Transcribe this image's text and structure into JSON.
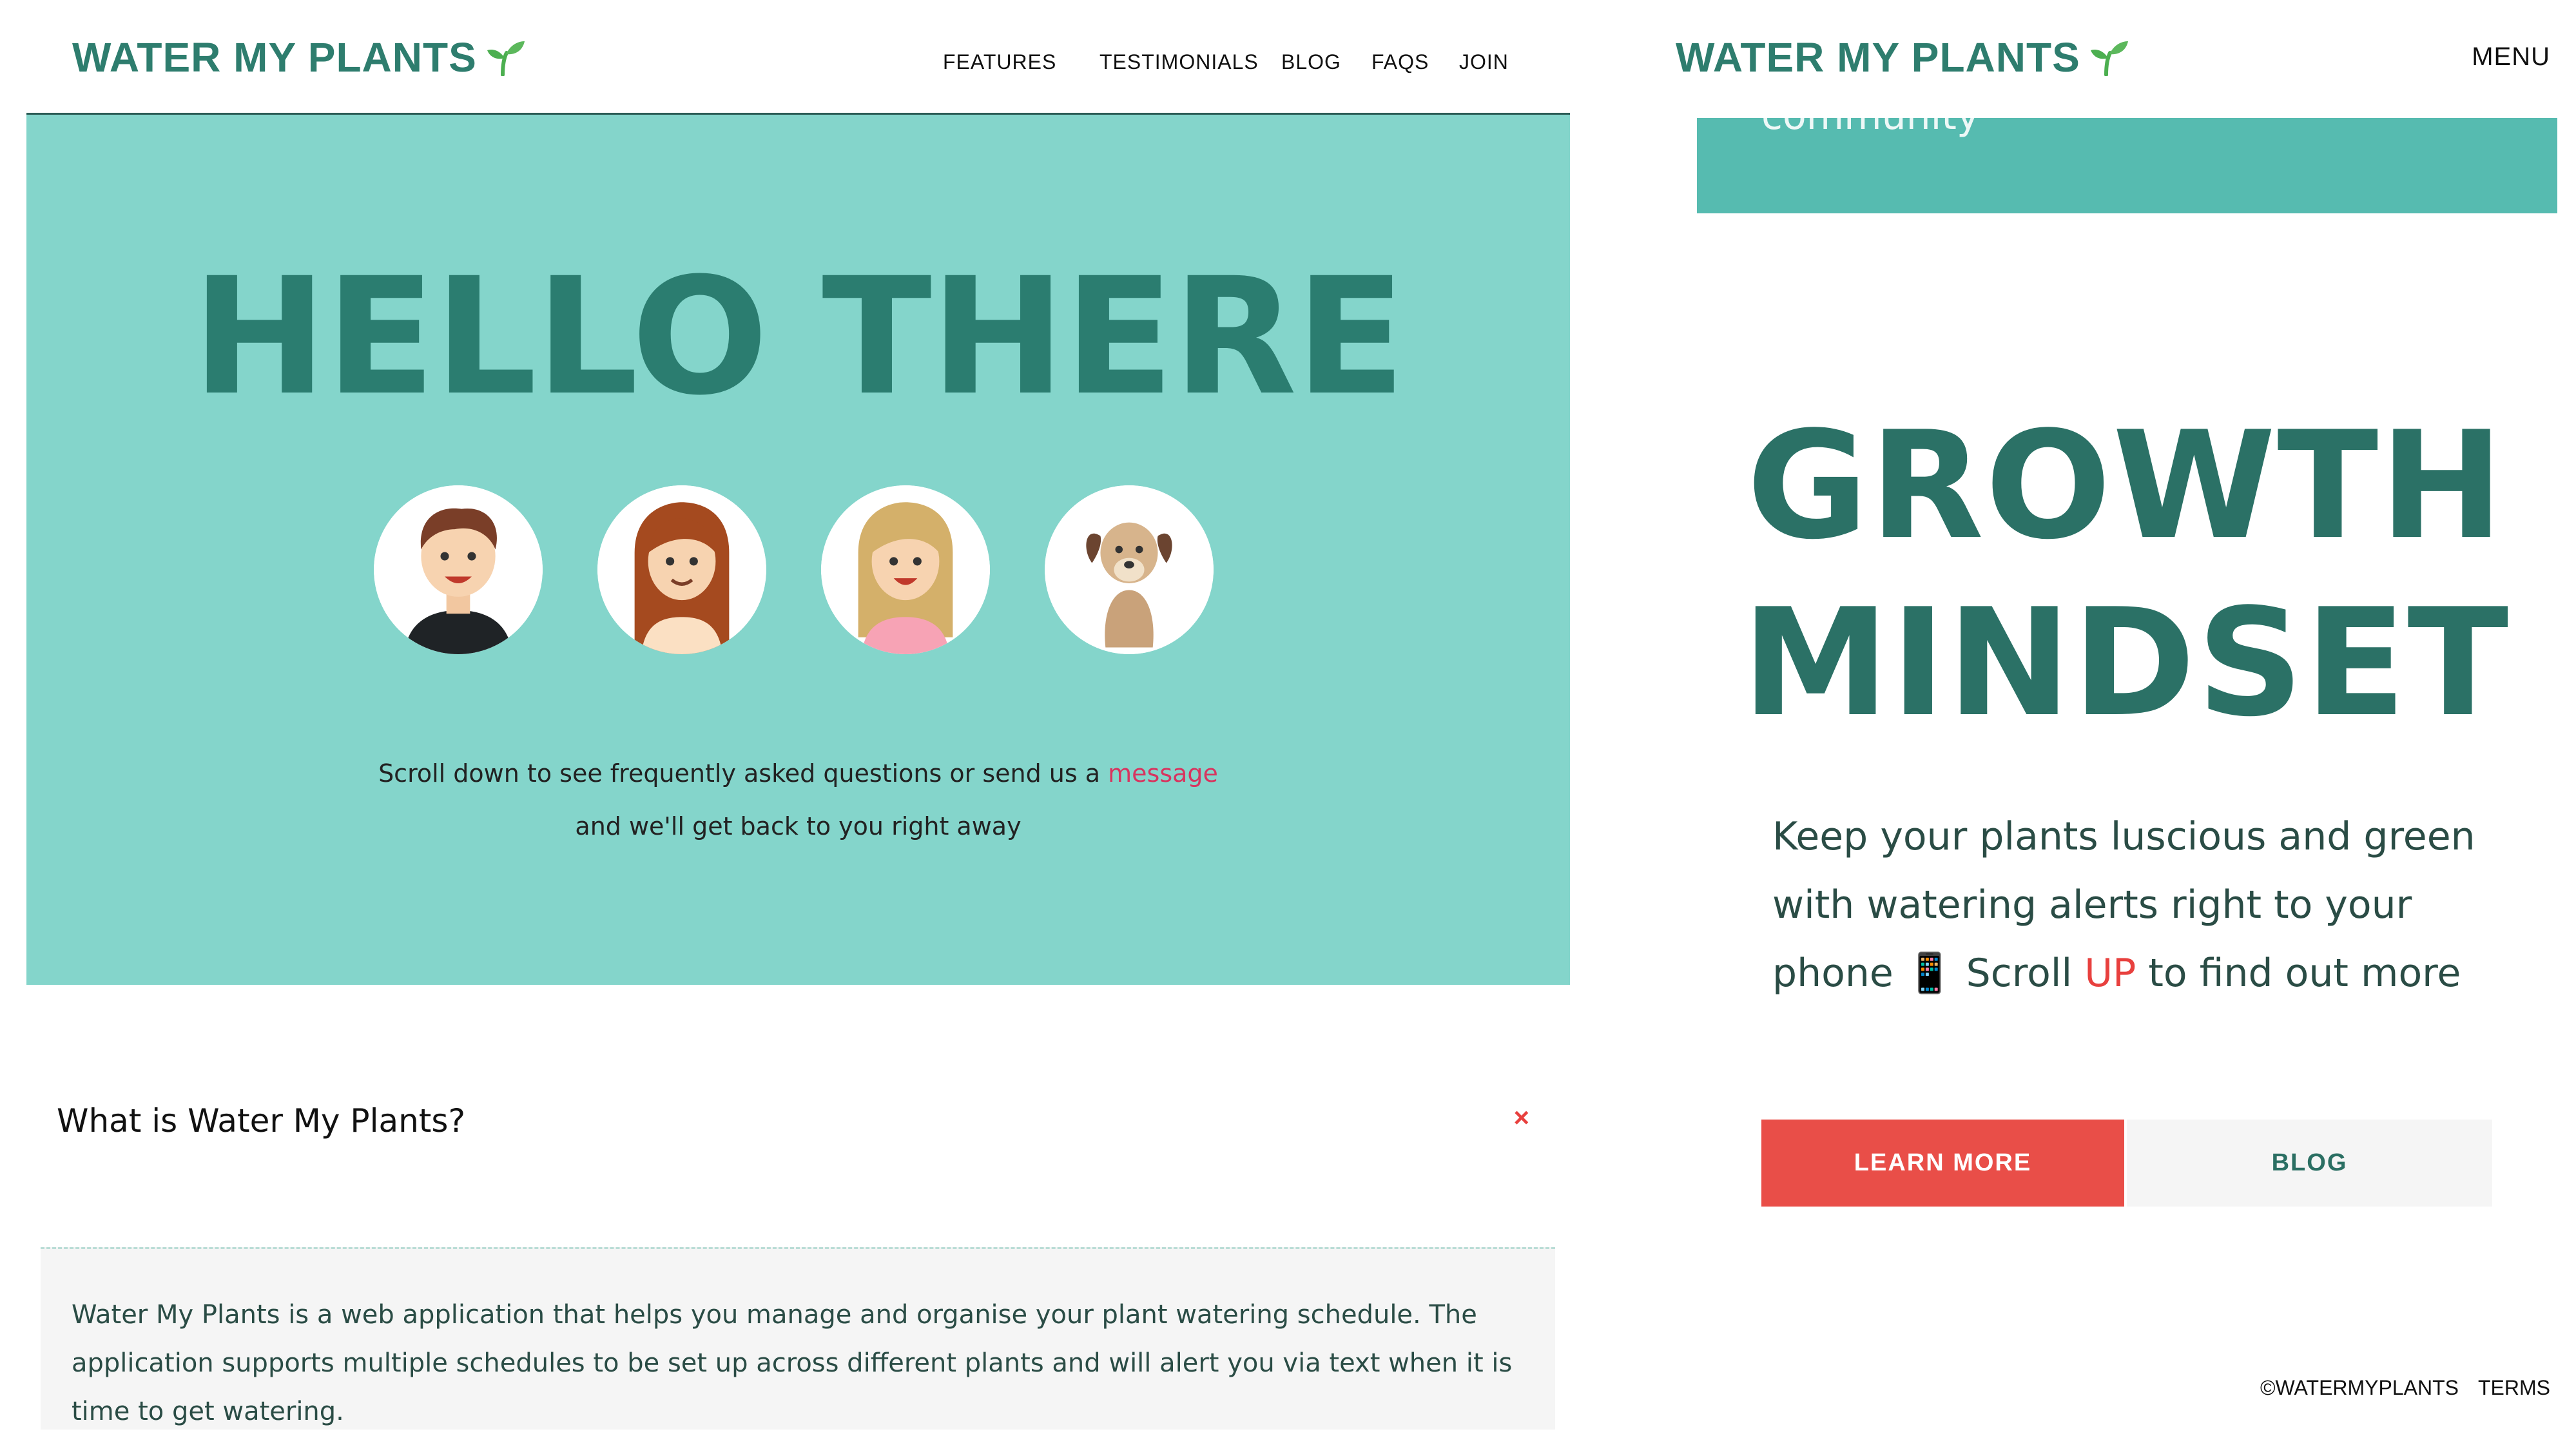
{
  "left_page": {
    "logo_text": "WATER MY PLANTS",
    "nav": [
      "FEATURES",
      "TESTIMONIALS",
      "BLOG",
      "FAQS",
      "JOIN"
    ],
    "hero": {
      "title": "HELLO THERE",
      "line1_prefix": "Scroll down to see frequently asked questions or send us a",
      "line1_link": "message",
      "line2": "and we'll get back to you right away"
    },
    "avatars": [
      "man-avatar",
      "woman-redhead-avatar",
      "woman-blonde-avatar",
      "dog-avatar"
    ],
    "faq": {
      "question": "What is Water My Plants?",
      "close_symbol": "×",
      "answer": "Water My Plants is a web application that helps you manage and organise your plant watering schedule. The application supports multiple schedules to be set up across different plants and will alert you via text when it is time to get watering."
    }
  },
  "right_page": {
    "logo_text": "WATER MY PLANTS",
    "menu_label": "MENU",
    "banner_text": "community",
    "title_line1": "GROWTH",
    "title_line2": "MINDSET",
    "tagline_part1": "Keep your plants luscious and green with watering alerts right to your phone",
    "tagline_phone": "📱",
    "tagline_scroll": "Scroll",
    "tagline_up": "UP",
    "tagline_end": "to find out more",
    "learn_more_label": "LEARN MORE",
    "blog_label": "BLOG",
    "footer": [
      "©WATERMYPLANTS",
      "TERMS"
    ]
  },
  "colors": {
    "brand_green": "#2e7d6e",
    "hero_teal": "#84d5cb",
    "banner_teal": "#56bbb0",
    "accent_red": "#e94e48",
    "link_pink": "#d8345f"
  }
}
